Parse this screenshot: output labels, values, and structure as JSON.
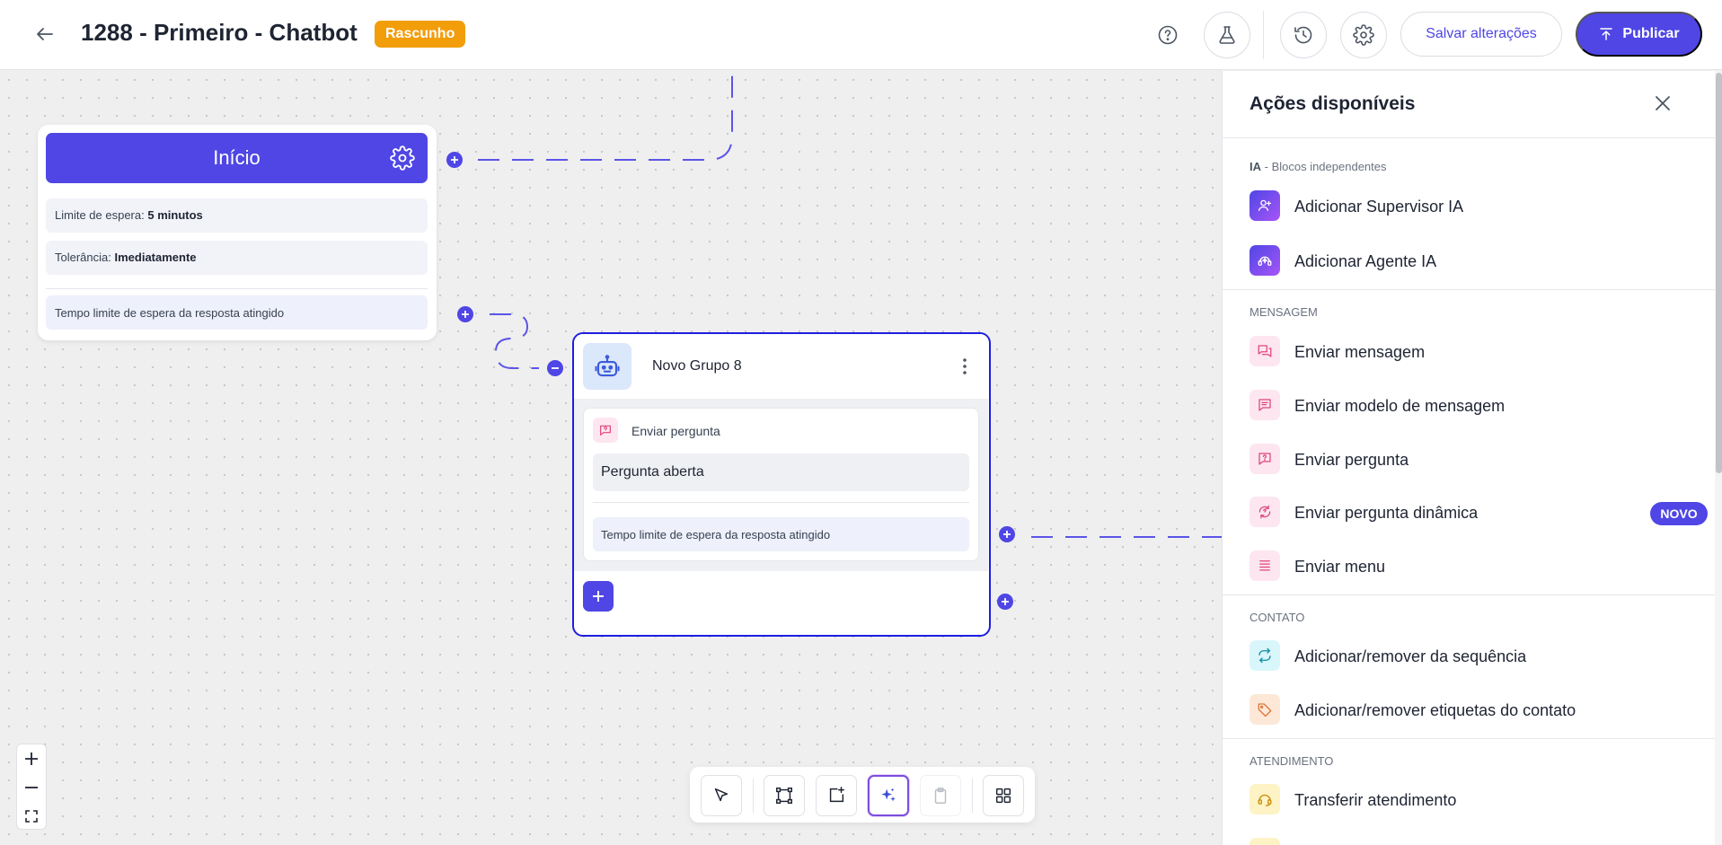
{
  "header": {
    "title": "1288 - Primeiro - Chatbot",
    "status_badge": "Rascunho",
    "help_icon": "help-circle-icon",
    "test_icon": "flask-icon",
    "history_icon": "history-icon",
    "settings_icon": "gear-icon",
    "save_label": "Salvar alterações",
    "publish_label": "Publicar"
  },
  "canvas": {
    "start_node": {
      "title": "Início",
      "wait_limit_label": "Limite de espera:",
      "wait_limit_value": "5 minutos",
      "tolerance_label": "Tolerância:",
      "tolerance_value": "Imediatamente",
      "timeout_label": "Tempo limite de espera da resposta atingido"
    },
    "group_node": {
      "name": "Novo Grupo 8",
      "step_type": "Enviar pergunta",
      "question": "Pergunta aberta",
      "timeout_label": "Tempo limite de espera da resposta atingido"
    }
  },
  "actions_panel": {
    "title": "Ações disponíveis",
    "sections": [
      {
        "title": "IA",
        "subtitle": "Blocos independentes",
        "items": [
          {
            "label": "Adicionar Supervisor IA",
            "icon": "supervisor-ai-icon"
          },
          {
            "label": "Adicionar Agente IA",
            "icon": "agent-ai-icon"
          }
        ]
      },
      {
        "title": "MENSAGEM",
        "items": [
          {
            "label": "Enviar mensagem",
            "icon": "chat-bubbles-icon"
          },
          {
            "label": "Enviar modelo de mensagem",
            "icon": "message-template-icon"
          },
          {
            "label": "Enviar pergunta",
            "icon": "question-bubble-icon"
          },
          {
            "label": "Enviar pergunta dinâmica",
            "icon": "dynamic-question-icon",
            "badge": "NOVO"
          },
          {
            "label": "Enviar menu",
            "icon": "menu-list-icon"
          }
        ]
      },
      {
        "title": "CONTATO",
        "items": [
          {
            "label": "Adicionar/remover da sequência",
            "icon": "sequence-cycle-icon"
          },
          {
            "label": "Adicionar/remover etiquetas do contato",
            "icon": "tag-icon"
          }
        ]
      },
      {
        "title": "ATENDIMENTO",
        "items": [
          {
            "label": "Transferir atendimento",
            "icon": "headset-icon"
          }
        ]
      }
    ]
  },
  "colors": {
    "accent": "#4f46e5",
    "draft_badge": "#f29d0a",
    "canvas_bg": "#efefef",
    "selected_border": "#1d1ee0"
  }
}
